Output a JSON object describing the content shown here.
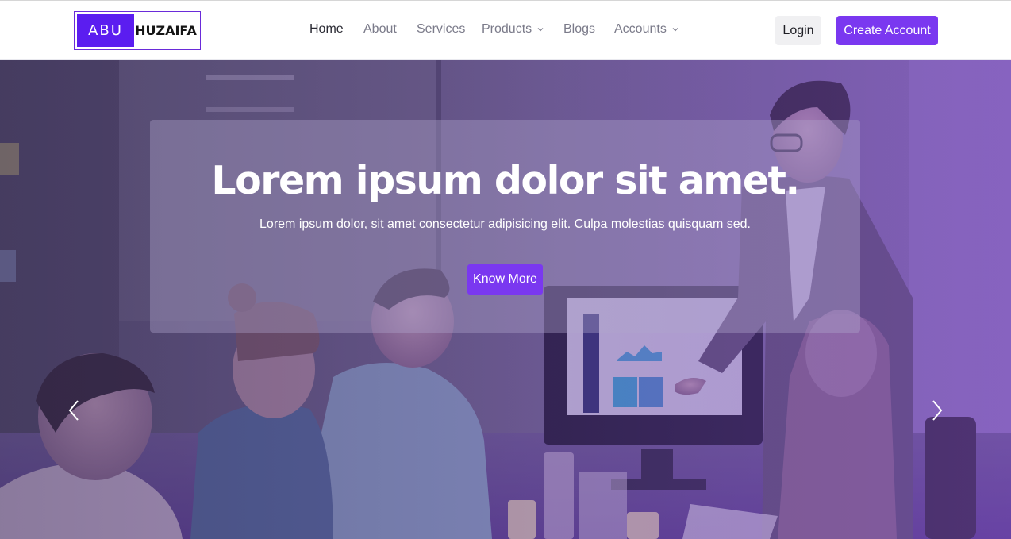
{
  "brand": {
    "part1": "ABU",
    "part2": "HUZAIFA"
  },
  "nav": {
    "items": [
      {
        "label": "Home"
      },
      {
        "label": "About"
      },
      {
        "label": "Services"
      },
      {
        "label": "Products"
      },
      {
        "label": "Blogs"
      },
      {
        "label": "Accounts"
      }
    ],
    "login_label": "Login",
    "create_account_label": "Create Account"
  },
  "hero": {
    "title": "Lorem ipsum dolor sit amet.",
    "subtitle": "Lorem ipsum dolor, sit amet consectetur adipisicing elit. Culpa molestias quisquam sed.",
    "button_label": "Know More"
  },
  "colors": {
    "accent": "#7a38f0",
    "brand_block": "#5b1df0",
    "overlay_purple": "#6a3fb0"
  },
  "icons": [
    "chevron-down-icon",
    "chevron-left-icon",
    "chevron-right-icon"
  ]
}
